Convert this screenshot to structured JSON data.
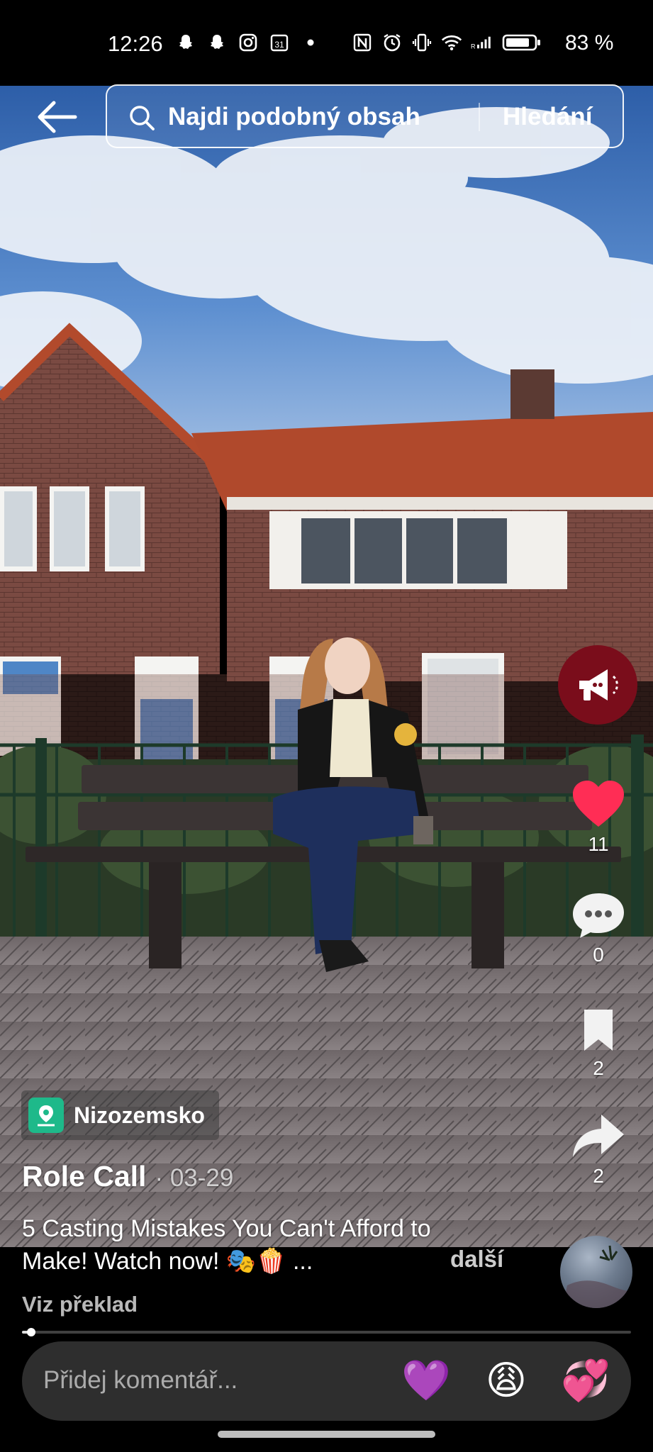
{
  "status_bar": {
    "time": "12:26",
    "calendar_day": "31",
    "battery_percent": "83 %",
    "left_icons": [
      "snapchat-icon",
      "snapchat-icon",
      "instagram-icon",
      "calendar-icon",
      "dot-icon"
    ],
    "right_icons": [
      "nfc-icon",
      "alarm-icon",
      "vibrate-icon",
      "wifi-icon",
      "signal-icon",
      "battery-icon"
    ]
  },
  "search": {
    "placeholder": "Najdi podobný obsah",
    "button_label": "Hledání"
  },
  "actions": {
    "likes": "11",
    "comments": "0",
    "saves": "2",
    "shares": "2"
  },
  "post": {
    "location": "Nizozemsko",
    "author": "Role Call",
    "date": "· 03-29",
    "caption": "5 Casting Mistakes You Can't Afford to Make! Watch now! 🎭🍿 ...",
    "more_label": "další",
    "translate_label": "Viz překlad",
    "progress": 0.01
  },
  "comment_bar": {
    "placeholder": "Přidej komentář...",
    "emojis": [
      "💜",
      "😩",
      "💞"
    ]
  },
  "colors": {
    "like": "#ff2d55",
    "promo": "#7a0d1b",
    "location": "#1eb98a",
    "comment_bar": "#2e2e2e"
  }
}
